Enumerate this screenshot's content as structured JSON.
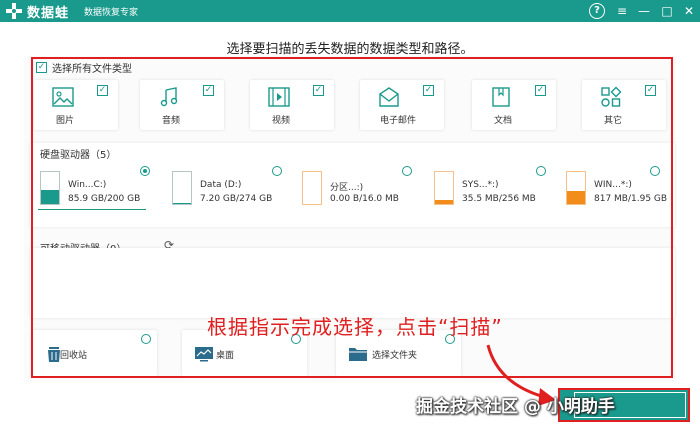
{
  "titlebar": {
    "app_name": "数据蛙",
    "app_subtitle": "数据恢复专家",
    "help": "?",
    "menu": "≡",
    "minimize": "—",
    "maximize": "□",
    "close": "✕"
  },
  "heading": "选择要扫描的丢失数据的数据类型和路径。",
  "select_all": "选择所有文件类型",
  "file_types": [
    {
      "label": "图片",
      "icon": "image-icon",
      "checked": true
    },
    {
      "label": "音频",
      "icon": "music-icon",
      "checked": true
    },
    {
      "label": "视频",
      "icon": "video-icon",
      "checked": true
    },
    {
      "label": "电子邮件",
      "icon": "email-icon",
      "checked": true
    },
    {
      "label": "文档",
      "icon": "document-icon",
      "checked": true
    },
    {
      "label": "其它",
      "icon": "other-icon",
      "checked": true
    }
  ],
  "hard_drives_label": "硬盘驱动器（5）",
  "drives": [
    {
      "name": "Win...C:)",
      "size": "85.9 GB/200 GB",
      "used": 0.43,
      "selected": true
    },
    {
      "name": "Data (D:)",
      "size": "7.20 GB/274 GB",
      "used": 0.03,
      "selected": false
    },
    {
      "name": "分区...:)",
      "size": "0.00  B/16.0 MB",
      "used": 0.0,
      "selected": false
    },
    {
      "name": "SYS...*:)",
      "size": "35.5 MB/256 MB",
      "used": 0.14,
      "selected": false
    },
    {
      "name": "WIN...*:)",
      "size": "817 MB/1.95 GB",
      "used": 0.42,
      "selected": false
    }
  ],
  "removable_label": "可移动驱动器（0）",
  "locations": [
    {
      "label": "回收站",
      "icon": "recycle-bin-icon"
    },
    {
      "label": "桌面",
      "icon": "desktop-icon"
    },
    {
      "label": "选择文件夹",
      "icon": "folder-icon"
    }
  ],
  "annotation": "根据指示完成选择，点击“扫描”",
  "watermark": "掘金技术社区 @ 小明助手",
  "colors": {
    "accent": "#1a9a8c",
    "annotation": "#e02020",
    "drive_orange": "#f28c1a"
  }
}
